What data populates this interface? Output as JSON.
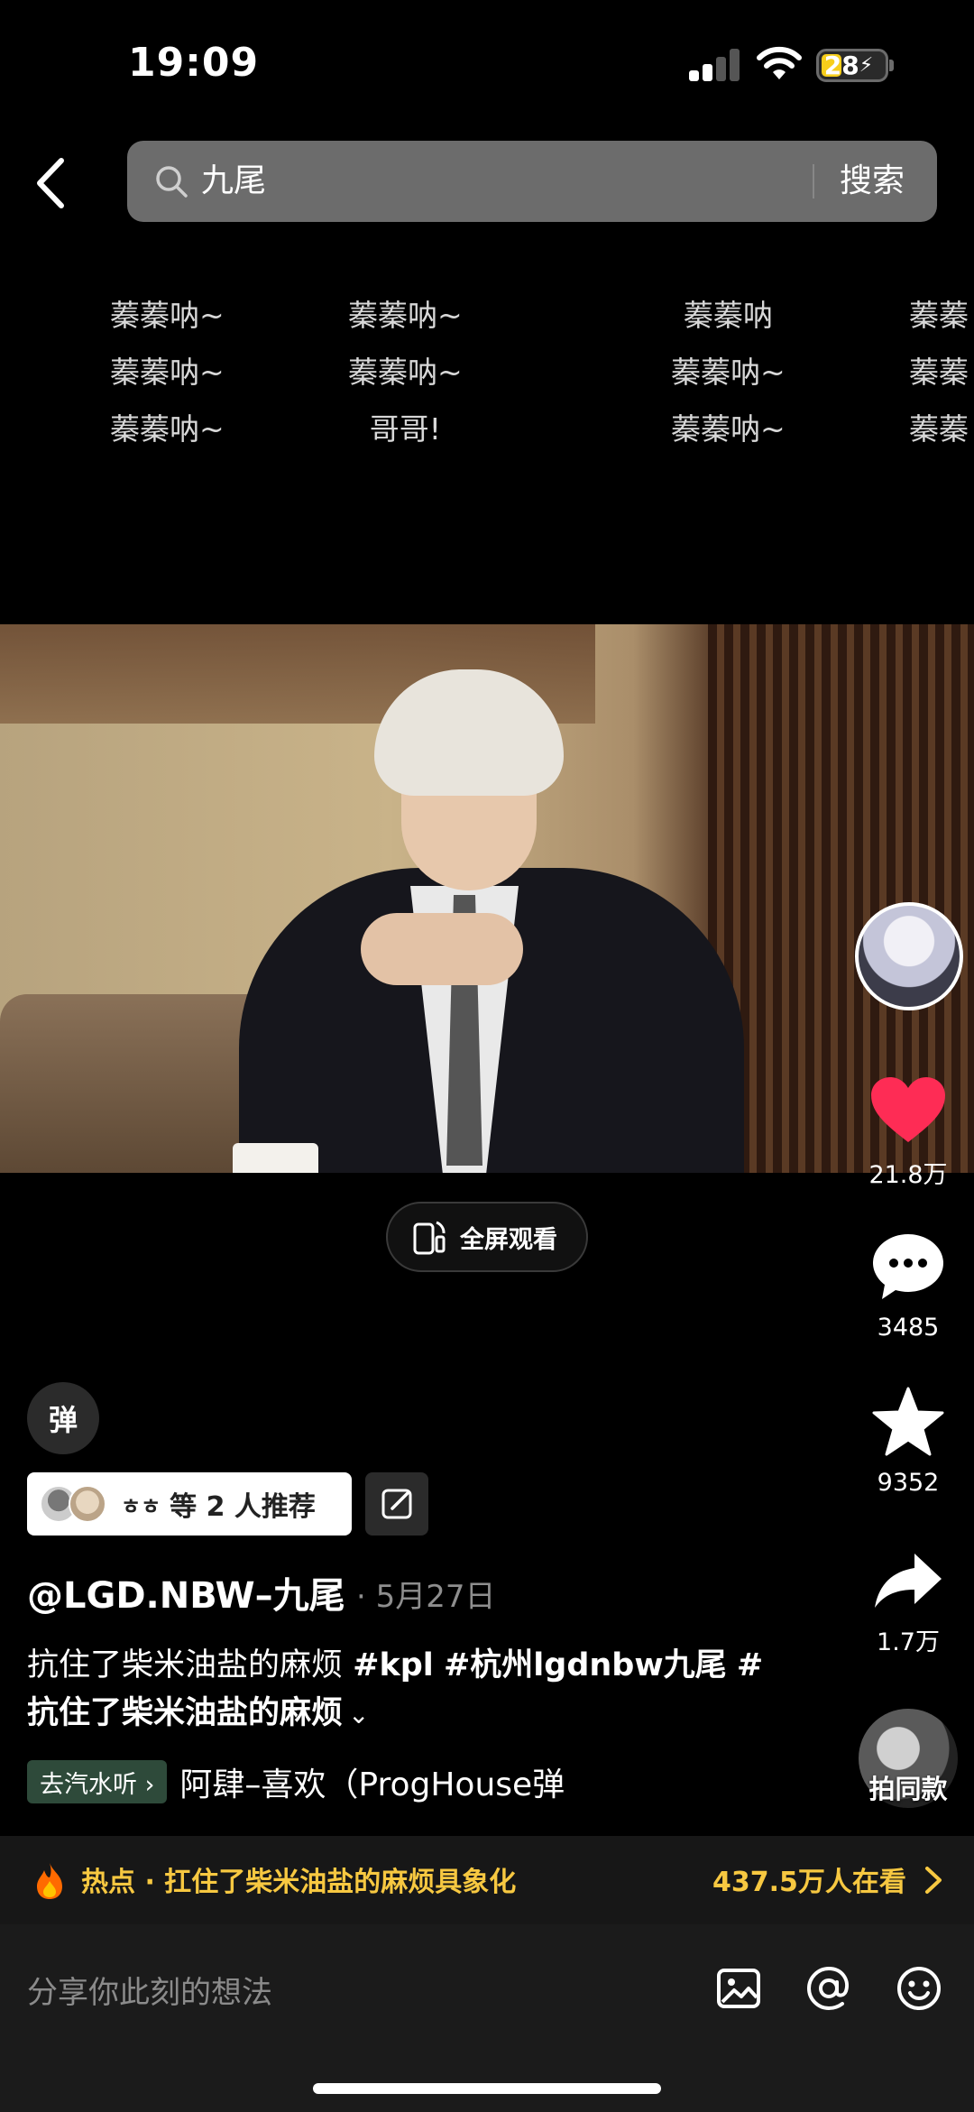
{
  "status_bar": {
    "time": "19:09",
    "battery": "28"
  },
  "search": {
    "query": "九尾",
    "submit_label": "搜索"
  },
  "lyric_columns": [
    [
      "蓁蓁呐~",
      "蓁蓁呐~",
      "蓁蓁呐~"
    ],
    [
      "蓁蓁呐~",
      "蓁蓁呐~",
      "哥哥!"
    ],
    [
      "蓁蓁呐",
      "蓁蓁呐~",
      "蓁蓁呐~"
    ],
    [
      "蓁蓁",
      "蓁蓁",
      "蓁蓁"
    ]
  ],
  "player": {
    "fullscreen_label": "全屏观看"
  },
  "sidebar": {
    "likes": "21.8万",
    "comments": "3485",
    "favorites": "9352",
    "shares": "1.7万",
    "remake_label": "拍同款"
  },
  "post": {
    "danmaku_toggle": "弹",
    "recommend_names": "ㅎㅎ",
    "recommend_text": "等 2 人推荐",
    "author": "@LGD.NBW–九尾",
    "date": "· 5月27日",
    "caption_prefix": "抗住了柴米油盐的麻烦 ",
    "tag1": "#kpl",
    "tag2": "#杭州lgdnbw九尾",
    "tag3": "#",
    "caption_suffix": "抗住了柴米油盐的麻烦",
    "music_chip": "去汽水听 ›",
    "music_title": "阿肆–喜欢（ProgHouse弹"
  },
  "hot": {
    "text": "热点 · 扛住了柴米油盐的麻烦具象化",
    "count": "437.5万人在看"
  },
  "comment": {
    "placeholder": "分享你此刻的想法"
  },
  "colors": {
    "accent_like": "#fe2c55",
    "hot_text": "#f7c841"
  }
}
